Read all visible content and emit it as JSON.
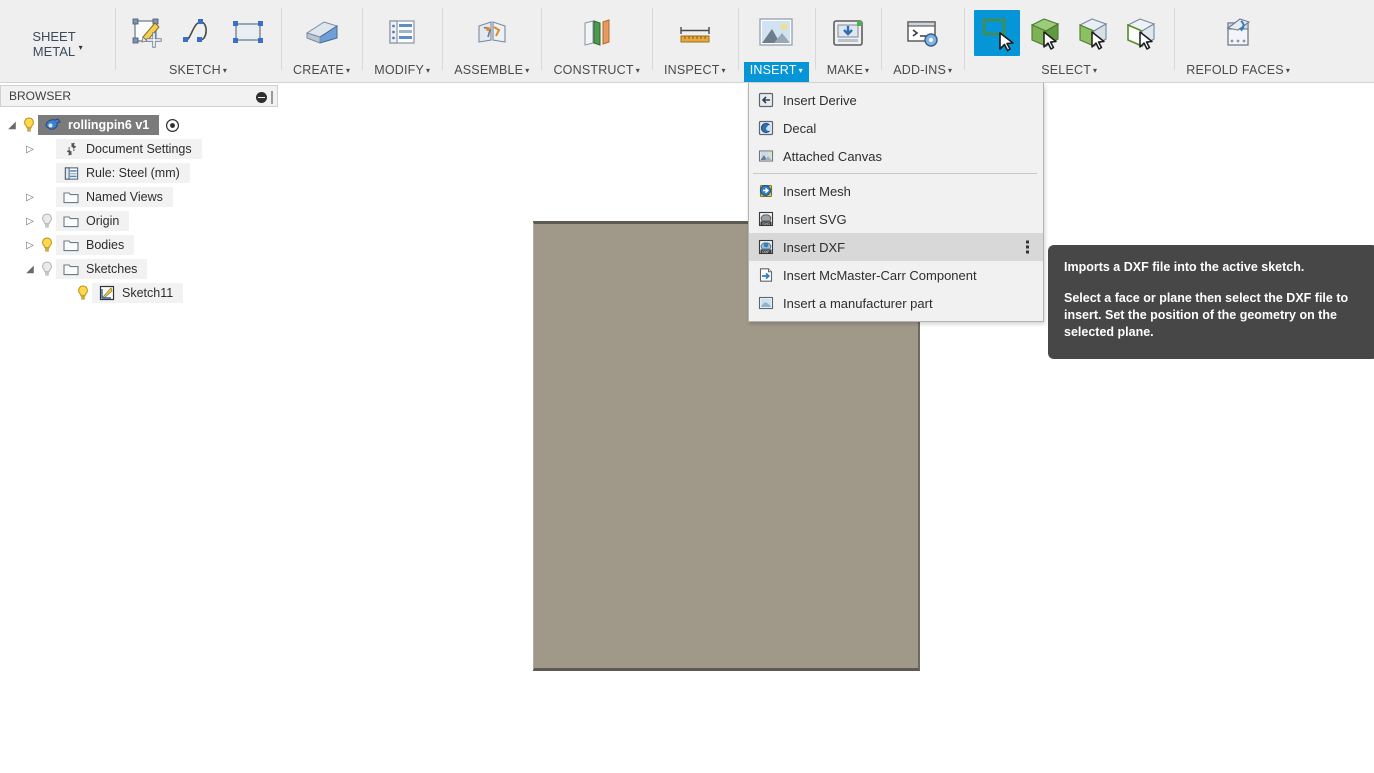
{
  "ribbon": {
    "workspace_tab": {
      "line1": "SHEET",
      "line2": "METAL",
      "caret": "▾"
    },
    "groups": [
      {
        "name": "sketch",
        "label": "SKETCH",
        "caret": "▾",
        "active": false
      },
      {
        "name": "create",
        "label": "CREATE",
        "caret": "▾",
        "active": false
      },
      {
        "name": "modify",
        "label": "MODIFY",
        "caret": "▾",
        "active": false
      },
      {
        "name": "assemble",
        "label": "ASSEMBLE",
        "caret": "▾",
        "active": false
      },
      {
        "name": "construct",
        "label": "CONSTRUCT",
        "caret": "▾",
        "active": false
      },
      {
        "name": "inspect",
        "label": "INSPECT",
        "caret": "▾",
        "active": false
      },
      {
        "name": "insert",
        "label": "INSERT",
        "caret": "▾",
        "active": true
      },
      {
        "name": "make",
        "label": "MAKE",
        "caret": "▾",
        "active": false
      },
      {
        "name": "addins",
        "label": "ADD-INS",
        "caret": "▾",
        "active": false
      },
      {
        "name": "select",
        "label": "SELECT",
        "caret": "▾",
        "active": false
      },
      {
        "name": "refold",
        "label": "REFOLD FACES",
        "caret": "▾",
        "active": false
      }
    ],
    "labels": {
      "sheet_metal_l1": "SHEET",
      "sheet_metal_l2": "METAL",
      "sketch": "SKETCH",
      "create": "CREATE",
      "modify": "MODIFY",
      "assemble": "ASSEMBLE",
      "construct": "CONSTRUCT",
      "inspect": "INSPECT",
      "insert": "INSERT",
      "make": "MAKE",
      "addins": "ADD-INS",
      "select": "SELECT",
      "refold": "REFOLD FACES"
    },
    "icons": {
      "create_sketch": "create-sketch-icon",
      "spline": "spline-icon",
      "rectangle": "rectangle-icon",
      "flange": "flange-icon",
      "modify_list": "modify-list-icon",
      "joint": "joint-icon",
      "construct_plane": "construct-plane-icon",
      "measure": "measure-ruler-icon",
      "insert_image": "insert-image-icon",
      "make_3dprint": "3d-print-icon",
      "addins_script": "script-console-icon",
      "select_window": "window-select-icon",
      "select_body": "select-body-icon",
      "select_face": "select-face-icon",
      "select_sketch": "select-sketch-icon",
      "refold_faces": "refold-faces-icon"
    },
    "accent_color": "#0696d7"
  },
  "browser": {
    "title": "BROWSER",
    "collapse_icon": "circle-minus-icon",
    "grip_icon": "panel-grip-icon",
    "tree": [
      {
        "id": "root",
        "label": "rollingpin6 v1",
        "arrow": "◢",
        "bulb": "on",
        "icon": "component-icon",
        "indent": 0,
        "selected": true,
        "trailing_icon": "activate-component-icon"
      },
      {
        "id": "document-settings",
        "label": "Document Settings",
        "arrow": "▷",
        "bulb": "none",
        "icon": "gear-icon",
        "indent": 1,
        "selected": false,
        "trailing_icon": ""
      },
      {
        "id": "rule",
        "label": "Rule: Steel (mm)",
        "arrow": "",
        "bulb": "none",
        "icon": "rule-list-icon",
        "indent": 1,
        "selected": false,
        "trailing_icon": ""
      },
      {
        "id": "named-views",
        "label": "Named Views",
        "arrow": "▷",
        "bulb": "none",
        "icon": "folder-icon",
        "indent": 1,
        "selected": false,
        "trailing_icon": ""
      },
      {
        "id": "origin",
        "label": "Origin",
        "arrow": "▷",
        "bulb": "off",
        "icon": "folder-icon",
        "indent": 1,
        "selected": false,
        "trailing_icon": ""
      },
      {
        "id": "bodies",
        "label": "Bodies",
        "arrow": "▷",
        "bulb": "on",
        "icon": "folder-icon",
        "indent": 1,
        "selected": false,
        "trailing_icon": ""
      },
      {
        "id": "sketches",
        "label": "Sketches",
        "arrow": "◢",
        "bulb": "off",
        "icon": "folder-icon",
        "indent": 1,
        "selected": false,
        "trailing_icon": ""
      },
      {
        "id": "sketch11",
        "label": "Sketch11",
        "arrow": "",
        "bulb": "on",
        "icon": "sketch-icon",
        "indent": 3,
        "selected": false,
        "trailing_icon": ""
      }
    ]
  },
  "insert_menu": {
    "items": [
      {
        "id": "insert-derive",
        "label": "Insert Derive",
        "icon": "insert-derive-icon",
        "hover": false,
        "kebab": false,
        "separator_after": false
      },
      {
        "id": "decal",
        "label": "Decal",
        "icon": "decal-icon",
        "hover": false,
        "kebab": false,
        "separator_after": false
      },
      {
        "id": "attached-canvas",
        "label": "Attached Canvas",
        "icon": "attached-canvas-icon",
        "hover": false,
        "kebab": false,
        "separator_after": true
      },
      {
        "id": "insert-mesh",
        "label": "Insert Mesh",
        "icon": "insert-mesh-icon",
        "hover": false,
        "kebab": false,
        "separator_after": false
      },
      {
        "id": "insert-svg",
        "label": "Insert SVG",
        "icon": "insert-svg-icon",
        "hover": false,
        "kebab": false,
        "separator_after": false
      },
      {
        "id": "insert-dxf",
        "label": "Insert DXF",
        "icon": "insert-dxf-icon",
        "hover": true,
        "kebab": true,
        "separator_after": false
      },
      {
        "id": "insert-mcmaster-carr",
        "label": "Insert McMaster-Carr Component",
        "icon": "insert-mcmaster-icon",
        "hover": false,
        "kebab": false,
        "separator_after": false
      },
      {
        "id": "insert-manufacturer-part",
        "label": "Insert a manufacturer part",
        "icon": "insert-manufacturer-part-icon",
        "hover": false,
        "kebab": false,
        "separator_after": false
      }
    ]
  },
  "tooltip": {
    "title": "Imports a DXF file into the active sketch.",
    "body": "Select a face or plane then select the DXF file to insert. Set the position of the geometry on the selected plane."
  },
  "canvas": {
    "body_name": "sheet-metal-body",
    "body_color": "#a0998a",
    "background_color": "#ffffff"
  }
}
